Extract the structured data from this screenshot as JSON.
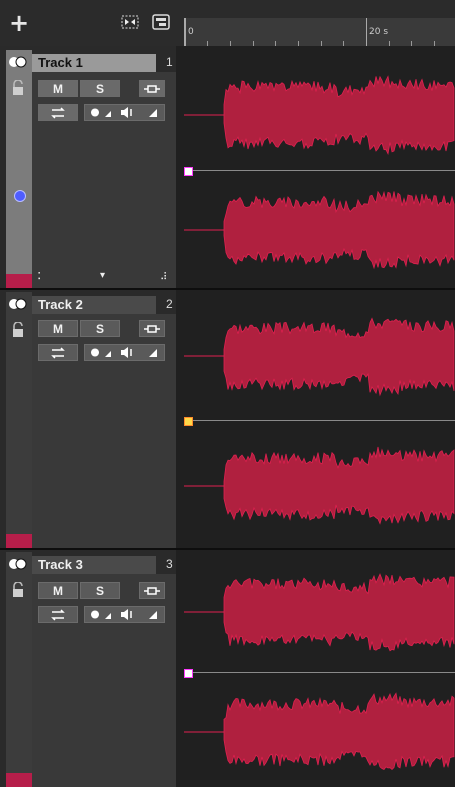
{
  "toolbar": {
    "add_label": "+",
    "icons": [
      "fit-view-icon",
      "track-layout-icon"
    ]
  },
  "ruler": {
    "labels": [
      "0",
      "20 s"
    ]
  },
  "tracks": [
    {
      "name": "Track 1",
      "number": "1",
      "mute": "M",
      "solo": "S",
      "selected": true
    },
    {
      "name": "Track 2",
      "number": "2",
      "mute": "M",
      "solo": "S",
      "selected": false
    },
    {
      "name": "Track 3",
      "number": "3",
      "mute": "M",
      "solo": "S",
      "selected": false
    }
  ],
  "colors": {
    "track_color": "#b61e4a",
    "waveform_fill": "#b0203f",
    "waveform_edge": "#e02050",
    "selection_node": "#4f5dff"
  }
}
